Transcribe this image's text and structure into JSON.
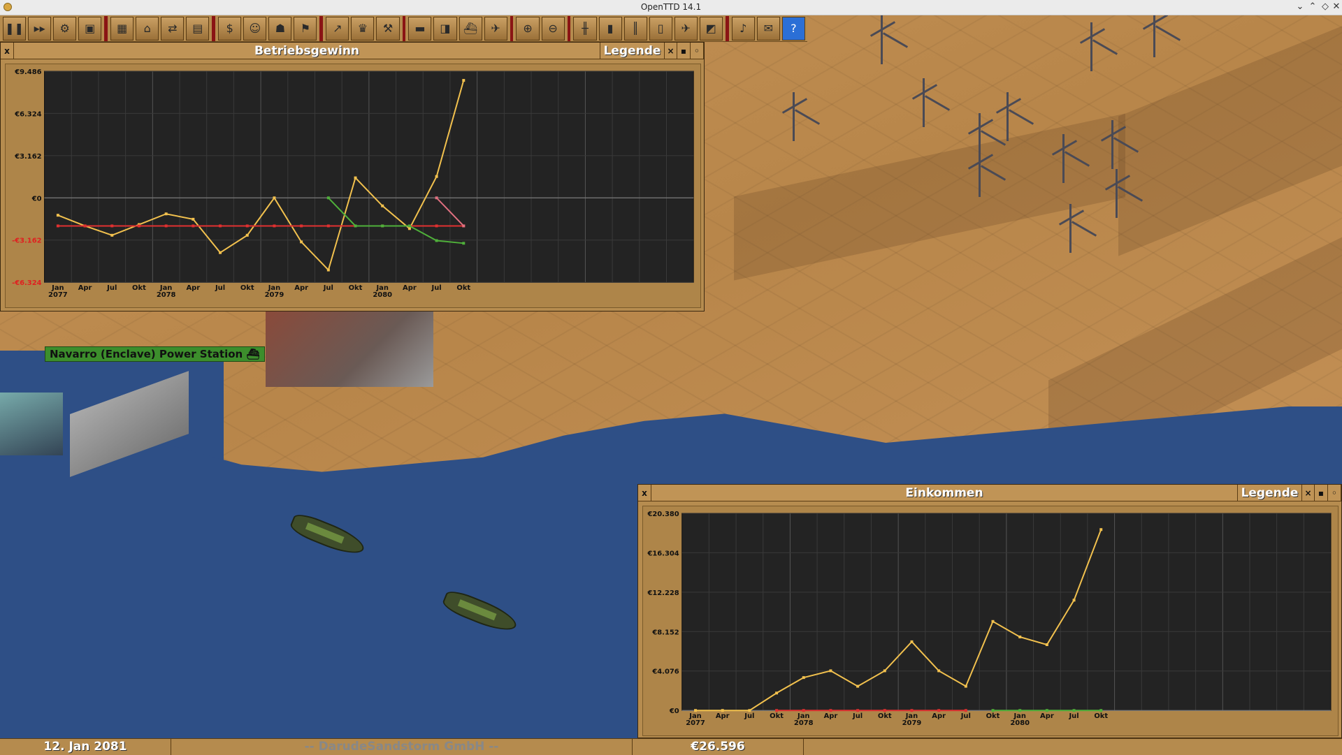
{
  "window": {
    "title": "OpenTTD 14.1",
    "controls": [
      "⌄",
      "⌃",
      "◇",
      "✕"
    ]
  },
  "toolbar": {
    "groups": [
      [
        "pause-icon",
        "fast-forward-icon",
        "settings-icon",
        "save-icon"
      ],
      [
        "minimap-icon",
        "town-directory-icon",
        "subsidies-icon",
        "station-list-icon"
      ],
      [
        "finances-icon",
        "company-icon",
        "story-icon",
        "goals-icon"
      ],
      [
        "graphs-icon",
        "league-icon",
        "industry-icon"
      ],
      [
        "train-list-icon",
        "road-vehicle-list-icon",
        "ship-list-icon",
        "aircraft-list-icon"
      ],
      [
        "zoom-in-icon",
        "zoom-out-icon"
      ],
      [
        "build-railway-icon",
        "build-road-icon",
        "build-tramway-icon",
        "build-docks-icon",
        "build-airport-icon",
        "landscaping-icon"
      ],
      [
        "sound-icon",
        "message-icon",
        "help-icon"
      ]
    ]
  },
  "town_sign": {
    "label": "Navarro (Enclave) Power Station"
  },
  "status": {
    "date": "12. Jan 2081",
    "company": "-- DarudeSandstorm GmbH --",
    "money": "€26.596"
  },
  "windows": {
    "profit": {
      "title": "Betriebsgewinn",
      "legend_label": "Legende",
      "close": "x",
      "shade": "▪",
      "sticky": "◦"
    },
    "income": {
      "title": "Einkommen",
      "legend_label": "Legende",
      "close": "x",
      "shade": "▪",
      "sticky": "◦"
    }
  },
  "chart_data": [
    {
      "type": "line",
      "title": "Betriebsgewinn",
      "x": [
        "Jan 2077",
        "Apr",
        "Jul",
        "Okt",
        "Jan 2078",
        "Apr",
        "Jul",
        "Okt",
        "Jan 2079",
        "Apr",
        "Jul",
        "Okt",
        "Jan 2080",
        "Apr",
        "Jul",
        "Okt"
      ],
      "x_major": [
        "Jan",
        "Apr",
        "Jul",
        "Okt",
        "Jan",
        "Apr",
        "Jul",
        "Okt",
        "Jan",
        "Apr",
        "Jul",
        "Okt",
        "Jan",
        "Apr",
        "Jul",
        "Okt"
      ],
      "x_minor": [
        "2077",
        "",
        "",
        "",
        "2078",
        "",
        "",
        "",
        "2079",
        "",
        "",
        "",
        "2080",
        "",
        "",
        ""
      ],
      "slots": 24,
      "yticks": [
        "€9.486",
        "€6.324",
        "€3.162",
        "€0",
        "-€3.162",
        "-€6.324"
      ],
      "ylim": [
        -6324,
        9486
      ],
      "grid": true,
      "series": [
        {
          "color": "#f2c14e",
          "values": [
            -1300,
            -2100,
            -2800,
            -2000,
            -1200,
            -1600,
            -4100,
            -2800,
            0,
            -3300,
            -5400,
            1500,
            -600,
            -2300,
            1600,
            8800
          ]
        },
        {
          "color": "#e03030",
          "values": [
            -2100,
            -2100,
            -2100,
            -2100,
            -2100,
            -2100,
            -2100,
            -2100,
            -2100,
            -2100,
            -2100,
            -2100,
            -2100,
            -2100,
            -2100,
            -2100
          ]
        },
        {
          "color": "#4fb03a",
          "values": [
            null,
            null,
            null,
            null,
            null,
            null,
            null,
            null,
            null,
            null,
            0,
            -2100,
            -2100,
            -2100,
            -3200,
            -3400
          ]
        },
        {
          "color": "#e07080",
          "values": [
            null,
            null,
            null,
            null,
            null,
            null,
            null,
            null,
            null,
            null,
            null,
            null,
            null,
            null,
            0,
            -2100
          ]
        }
      ]
    },
    {
      "type": "line",
      "title": "Einkommen",
      "x": [
        "Jan 2077",
        "Apr",
        "Jul",
        "Okt",
        "Jan 2078",
        "Apr",
        "Jul",
        "Okt",
        "Jan 2079",
        "Apr",
        "Jul",
        "Okt",
        "Jan 2080",
        "Apr",
        "Jul",
        "Okt"
      ],
      "x_major": [
        "Jan",
        "Apr",
        "Jul",
        "Okt",
        "Jan",
        "Apr",
        "Jul",
        "Okt",
        "Jan",
        "Apr",
        "Jul",
        "Okt",
        "Jan",
        "Apr",
        "Jul",
        "Okt"
      ],
      "x_minor": [
        "2077",
        "",
        "",
        "",
        "2078",
        "",
        "",
        "",
        "2079",
        "",
        "",
        "",
        "2080",
        "",
        "",
        ""
      ],
      "slots": 24,
      "yticks": [
        "€20.380",
        "€16.304",
        "€12.228",
        "€8.152",
        "€4.076",
        "€0"
      ],
      "ylim": [
        0,
        20380
      ],
      "grid": true,
      "series": [
        {
          "color": "#f2c14e",
          "values": [
            0,
            0,
            0,
            1800,
            3400,
            4100,
            2500,
            4100,
            7100,
            4100,
            2500,
            9200,
            7600,
            6800,
            11400,
            18700
          ]
        },
        {
          "color": "#e03030",
          "values": [
            null,
            null,
            null,
            0,
            0,
            0,
            0,
            0,
            0,
            0,
            0,
            null,
            null,
            null,
            null,
            null
          ]
        },
        {
          "color": "#4fb03a",
          "values": [
            null,
            null,
            null,
            null,
            null,
            null,
            null,
            null,
            null,
            null,
            null,
            0,
            0,
            0,
            0,
            0
          ]
        }
      ]
    }
  ]
}
